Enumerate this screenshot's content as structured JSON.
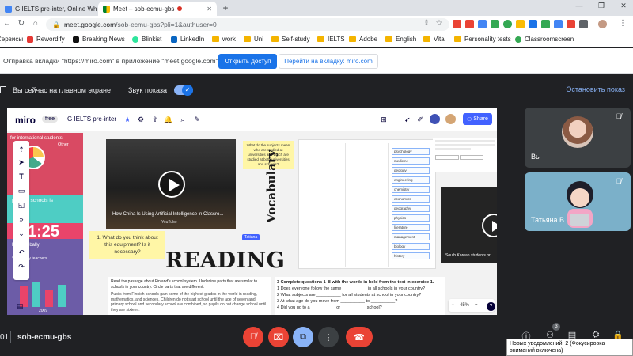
{
  "browser": {
    "tabs": [
      {
        "label": "G IELTS pre-inter, Online Wh",
        "active": false
      },
      {
        "label": "Meet – sob-ecmu-gbs",
        "active": true
      }
    ],
    "url_host": "meet.google.com",
    "url_path": "/sob-ecmu-gbs?pli=1&authuser=0",
    "bookmarks": [
      "Сервисы",
      "Rewordify",
      "Breaking News",
      "Blinkist",
      "LinkedIn",
      "work",
      "Uni",
      "Self-study",
      "IELTS",
      "Adobe",
      "English",
      "Vital",
      "Personality tests",
      "Classroomscreen"
    ]
  },
  "infobar": {
    "message": "Отправка вкладки \"https://miro.com\" в приложение \"meet.google.com\"...",
    "allow_label": "Открыть доступ",
    "switch_label": "Перейти на вкладку: miro.com"
  },
  "presenting": {
    "status": "Вы сейчас на главном экране",
    "sound_label": "Звук показа",
    "stop_label": "Остановить показ"
  },
  "miro": {
    "logo": "miro",
    "plan": "free",
    "board_name": "G IELTS pre-inter",
    "share_label": "Share",
    "banner": {
      "title": "for international students",
      "other": "Other",
      "primary": "primary schools is",
      "ratio": "1:25",
      "globally": "hays globally",
      "secondary": "Secondary teachers",
      "year": "2009"
    },
    "video1_title": "How China Is Using Artificial Intelligence in Classro...",
    "video1_source": "YouTube",
    "sticky_question": "1. What do you think about this equipment? Is it necessary?",
    "sticky_top": "What do the subjects mean who are studied at universities and which are studied at both universities and schools?",
    "cursor_tag": "Tatiana",
    "reading_title": "READING",
    "vocab_title": "Vocabulary",
    "vocab_words": [
      "psychology",
      "medicine",
      "geology",
      "engineering",
      "chemistry",
      "economics",
      "geography",
      "physics",
      "literature",
      "management",
      "biology",
      "history"
    ],
    "video2_title": "South Korean students pr...",
    "exercise1": "Read the passage about Finland's school system. Underline parts that are similar to schools in your country. Circle parts that are different.",
    "exercise1_body": "Pupils from Finnish schools gain some of the highest grades in the world in reading, mathematics, and sciences. Children do not start school until the age of seven and primary school and secondary school are combined, so pupils do not change school until they are sixteen.",
    "exercise3_title": "3   Complete questions 1–8 with the words in bold from the text in exercise 1.",
    "exercise3_q1": "1   Does everyone follow the same __________ in all schools in your country?",
    "exercise3_q2": "2   What subjects are __________ for all students at school in your country?",
    "exercise3_q3": "3   At what age do you move from __________ to __________?",
    "exercise3_q4": "4   Did you go to a __________ or __________ school?",
    "zoom": "45%"
  },
  "participants": [
    {
      "name": "Вы"
    },
    {
      "name": "Татьяна В..."
    }
  ],
  "bottom": {
    "time": "01",
    "meeting_code": "sob-ecmu-gbs",
    "people_count": "3"
  },
  "tooltip": "Новых уведомлений: 2 (Фокусировка вниманий включена)"
}
